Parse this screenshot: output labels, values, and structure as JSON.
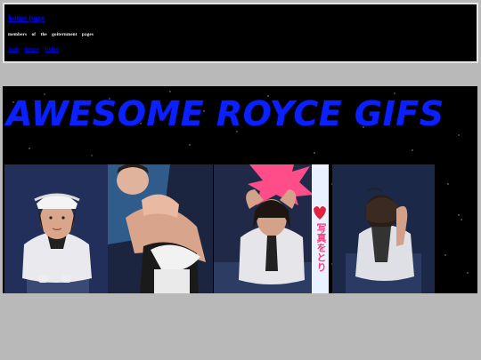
{
  "header": {
    "home_link": "home page",
    "subtitle": "members of the goiternment pages",
    "nav": [
      "Josh",
      "Royce",
      "Dylan"
    ]
  },
  "banner": {
    "title": "AWESOME ROYCE GIFS",
    "gifs": [
      {
        "name": "royce-gif-white-cap"
      },
      {
        "name": "royce-gif-pointing"
      },
      {
        "name": "royce-gif-photobooth",
        "caption": "写真をとり"
      },
      {
        "name": "royce-gif-looking-down"
      }
    ]
  },
  "colors": {
    "page_bg": "#b9b9b9",
    "header_bg": "#000000",
    "link": "#0000ee",
    "title": "#0a20ff"
  }
}
